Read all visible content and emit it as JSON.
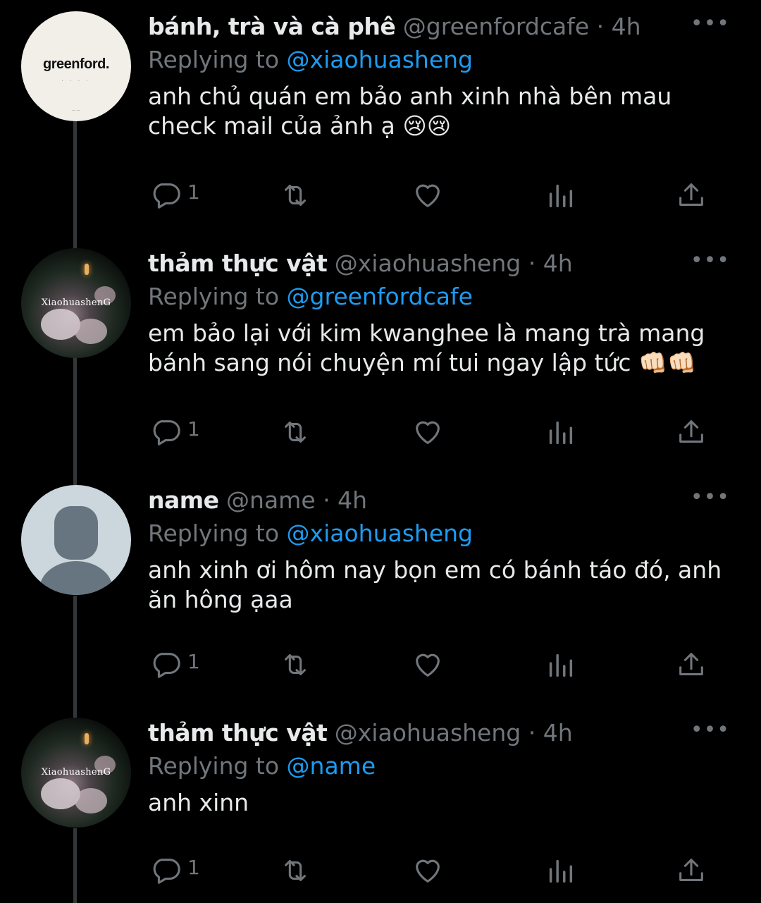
{
  "tweets": [
    {
      "name": "bánh, trà và cà phê",
      "handle": "@greenfordcafe",
      "time": "4h",
      "replying_label": "Replying to",
      "replying_to": "@xiaohuasheng",
      "text": "anh chủ quán em bảo anh xinh nhà bên mau check mail của ảnh ạ 😢😢",
      "reply_count": "1",
      "avatar": {
        "type": "logo",
        "logo_text": "greenford."
      }
    },
    {
      "name": "thảm thực vật",
      "handle": "@xiaohuasheng",
      "time": "4h",
      "replying_label": "Replying to",
      "replying_to": "@greenfordcafe",
      "text": "em bảo lại với kim kwanghee là mang trà mang bánh sang nói chuyện mí tui ngay lập tức 👊🏻👊🏻",
      "reply_count": "1",
      "avatar": {
        "type": "photo",
        "watermark": "XiaohuashenG"
      }
    },
    {
      "name": "name",
      "handle": "@name",
      "time": "4h",
      "replying_label": "Replying to",
      "replying_to": "@xiaohuasheng",
      "text": "anh xinh ơi hôm nay bọn em có bánh táo đó, anh ăn hông ạaa",
      "reply_count": "1",
      "avatar": {
        "type": "default"
      }
    },
    {
      "name": "thảm thực vật",
      "handle": "@xiaohuasheng",
      "time": "4h",
      "replying_label": "Replying to",
      "replying_to": "@name",
      "text": "anh xinn",
      "reply_count": "1",
      "avatar": {
        "type": "photo",
        "watermark": "XiaohuashenG"
      }
    }
  ],
  "icons": [
    "reply-icon",
    "retweet-icon",
    "like-icon",
    "views-icon",
    "share-icon",
    "more-icon"
  ],
  "colors": {
    "background": "#000000",
    "text": "#e7e9ea",
    "secondary": "#71767b",
    "accent": "#1d9bf0",
    "thread_line": "#333639"
  }
}
